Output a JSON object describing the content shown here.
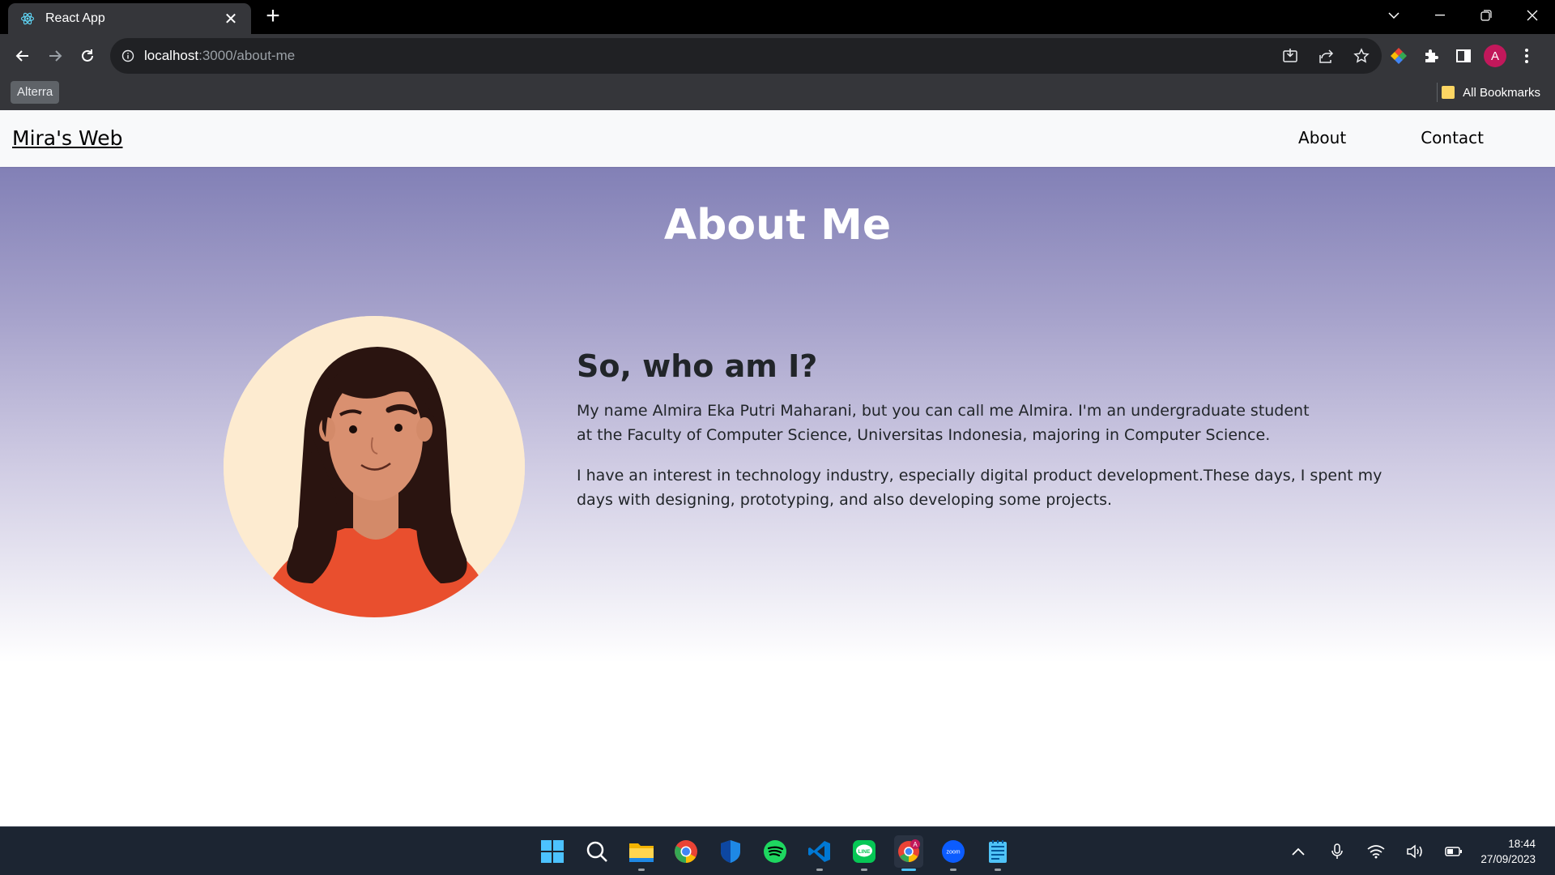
{
  "browser": {
    "tab_title": "React App",
    "url_host": "localhost",
    "url_path": ":3000/about-me",
    "bookmark_chip": "Alterra",
    "bookmarks_label": "All Bookmarks",
    "profile_initial": "A"
  },
  "site": {
    "brand": "Mira's Web",
    "nav": [
      {
        "label": "About"
      },
      {
        "label": "Contact"
      }
    ]
  },
  "about": {
    "title": "About Me",
    "heading": "So, who am I?",
    "paragraphs": [
      "My name Almira Eka Putri Maharani, but you can call me Almira. I'm an undergraduate student at the Faculty of Computer Science, Universitas Indonesia, majoring in Computer Science.",
      "I have an interest in technology industry, especially digital product development.These days, I spent my days with designing, prototyping, and also developing some projects."
    ]
  },
  "taskbar": {
    "time": "18:44",
    "date": "27/09/2023",
    "apps": [
      "windows-start",
      "search",
      "file-explorer",
      "chrome",
      "windows-security",
      "spotify",
      "vscode",
      "line",
      "chrome-profile",
      "zoom",
      "notepad"
    ]
  },
  "colors": {
    "hero_top": "#8280b6",
    "accent_shirt": "#e94f2e",
    "hair": "#2a1410",
    "skin": "#d99070"
  }
}
